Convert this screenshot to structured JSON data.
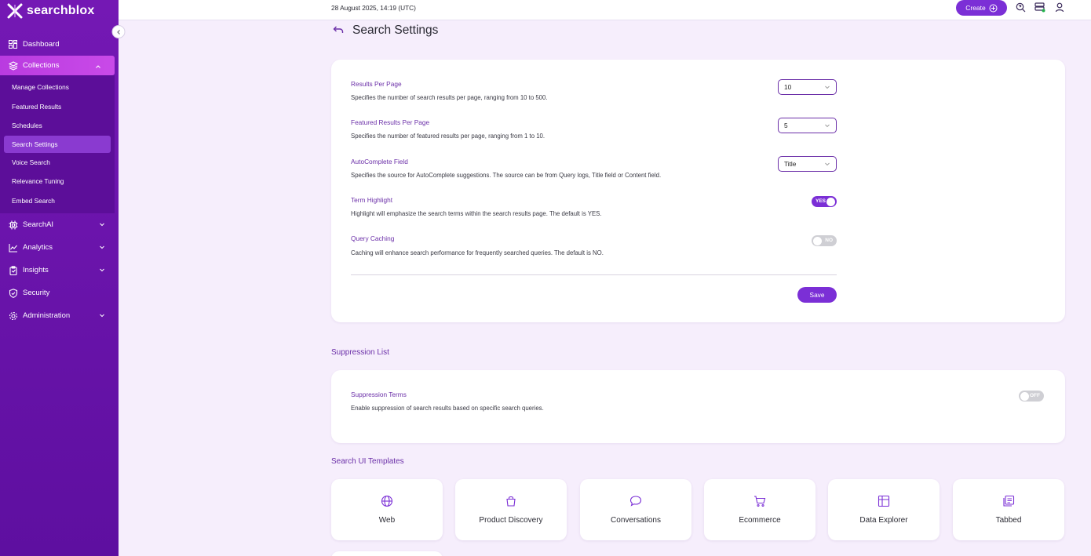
{
  "app": {
    "name": "searchblox"
  },
  "topbar": {
    "datetime": "28 August 2025, 14:19 (UTC)",
    "create_label": "Create"
  },
  "sidebar": {
    "items": [
      {
        "label": "Dashboard",
        "icon": "dashboard-icon"
      },
      {
        "label": "Collections",
        "icon": "layers-icon",
        "expanded": true
      },
      {
        "label": "SearchAI",
        "icon": "cpu-icon"
      },
      {
        "label": "Analytics",
        "icon": "chart-line-icon"
      },
      {
        "label": "Insights",
        "icon": "clipboard-icon"
      },
      {
        "label": "Security",
        "icon": "shield-icon"
      },
      {
        "label": "Administration",
        "icon": "gear-icon"
      }
    ],
    "sub_items": [
      {
        "label": "Manage Collections"
      },
      {
        "label": "Featured Results"
      },
      {
        "label": "Schedules"
      },
      {
        "label": "Search Settings",
        "active": true
      },
      {
        "label": "Voice Search"
      },
      {
        "label": "Relevance Tuning"
      },
      {
        "label": "Embed Search"
      }
    ]
  },
  "page": {
    "title": "Search Settings"
  },
  "settings": {
    "results_per_page": {
      "title": "Results Per Page",
      "desc": "Specifies the number of search results per page, ranging from 10 to 500.",
      "value": "10"
    },
    "featured_per_page": {
      "title": "Featured Results Per Page",
      "desc": "Specifies the number of featured results per page, ranging from 1 to 10.",
      "value": "5"
    },
    "autocomplete": {
      "title": "AutoComplete Field",
      "desc": "Specifies the source for AutoComplete suggestions. The source can be from Query logs, Title field or Content field.",
      "value": "Title"
    },
    "term_highlight": {
      "title": "Term Highlight",
      "desc": "Highlight will emphasize the search terms within the search results page. The default is YES.",
      "state": "YES"
    },
    "query_caching": {
      "title": "Query Caching",
      "desc": "Caching will enhance search performance for frequently searched queries. The default is NO.",
      "state": "NO"
    },
    "save_label": "Save"
  },
  "suppression": {
    "section_title": "Suppression List",
    "title": "Suppression Terms",
    "desc": "Enable suppression of search results based on specific search queries.",
    "state": "OFF"
  },
  "templates": {
    "section_title": "Search UI Templates",
    "items": [
      {
        "label": "Web",
        "icon": "globe-icon"
      },
      {
        "label": "Product Discovery",
        "icon": "shopping-bag-icon"
      },
      {
        "label": "Conversations",
        "icon": "chat-bubble-icon"
      },
      {
        "label": "Ecommerce",
        "icon": "cart-icon"
      },
      {
        "label": "Data Explorer",
        "icon": "table-icon"
      },
      {
        "label": "Tabbed",
        "icon": "tabs-icon"
      }
    ]
  },
  "colors": {
    "brand": "#7b2fd6",
    "sidebar": "#6a16a8",
    "accent_text": "#6b2fa8",
    "background": "#f6eefc"
  }
}
